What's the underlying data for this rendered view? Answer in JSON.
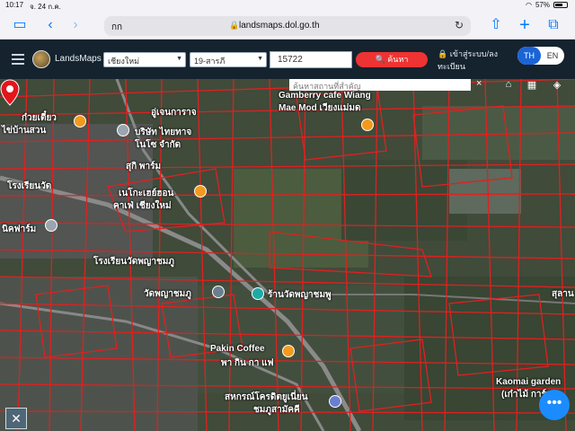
{
  "status": {
    "time": "10:17",
    "date": "จ. 24 ก.ค.",
    "wifi": "wifi-icon",
    "battery": "57%"
  },
  "browser": {
    "aa": "กก",
    "url": "landsmaps.dol.go.th"
  },
  "app": {
    "brand": "LandsMaps",
    "province": "เชียงใหม่",
    "district": "19-สารภี",
    "parcel": "15722",
    "search": "ค้นหา",
    "login": "เข้าสู่ระบบ/ลงทะเบียน",
    "lang_th": "TH",
    "lang_en": "EN"
  },
  "map": {
    "search_placeholder": "ค้นหาสถานที่สำคัญ",
    "close": "×",
    "labels": [
      "ก๋วยเตี๋ยว",
      "ไข่บ้านสวน",
      "อู่เจนการาจ",
      "บริษัท ไทยทาจ",
      "โนโซ จำกัด",
      "สุกิ พาร์ม",
      "Gamberry cafe Wiang",
      "Mae Mod เวียงแม่มด",
      "โรงเรียนวัด",
      "นิคฟาร์ม",
      "เนโกะเฮย์ฮอน",
      "คาเฟ่ เชียงใหม่",
      "โรงเรียนวัดพญาชมภู",
      "วัดพญาชมภู",
      "ร้านวัดพญาชมพู",
      "Pakin Coffee",
      "พา กิน กา แฟ",
      "สหกรณ์โครดิตยูเนี่ยน",
      "ชมภูสามัคคี",
      "Kaomai garden",
      "(เก๋าไม้ การ์เ",
      "สุลาน"
    ]
  }
}
